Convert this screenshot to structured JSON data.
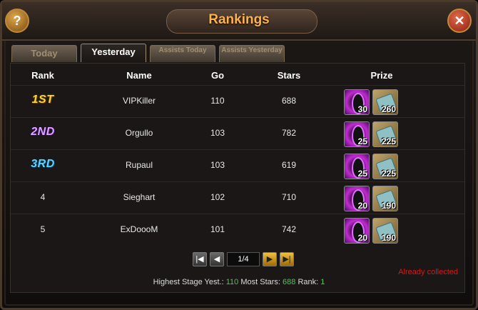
{
  "window": {
    "title": "Rankings"
  },
  "tabs": [
    {
      "label": "Today",
      "active": false
    },
    {
      "label": "Yesterday",
      "active": true
    },
    {
      "label": "Assists Today",
      "active": false
    },
    {
      "label": "Assists Yesterday",
      "active": false
    }
  ],
  "columns": {
    "rank": "Rank",
    "name": "Name",
    "go": "Go",
    "stars": "Stars",
    "prize": "Prize"
  },
  "rows": [
    {
      "rank": "1ST",
      "name": "VIPKiller",
      "go": "110",
      "stars": "688",
      "prize1": "30",
      "prize2": "260"
    },
    {
      "rank": "2ND",
      "name": "Orgullo",
      "go": "103",
      "stars": "782",
      "prize1": "25",
      "prize2": "225"
    },
    {
      "rank": "3RD",
      "name": "Rupaul",
      "go": "103",
      "stars": "619",
      "prize1": "25",
      "prize2": "225"
    },
    {
      "rank": "4",
      "name": "Sieghart",
      "go": "102",
      "stars": "710",
      "prize1": "20",
      "prize2": "190"
    },
    {
      "rank": "5",
      "name": "ExDoooM",
      "go": "101",
      "stars": "742",
      "prize1": "20",
      "prize2": "190"
    }
  ],
  "pager": {
    "page": "1/4"
  },
  "status": {
    "collected": "Already collected"
  },
  "footer": {
    "highest_label": "Highest Stage Yest.:",
    "highest_value": "110",
    "stars_label": "Most Stars:",
    "stars_value": "688",
    "rank_label": "Rank:",
    "rank_value": "1"
  },
  "icons": {
    "help": "question-icon",
    "close": "close-icon",
    "prize1": "dark-gem-icon",
    "prize2": "scroll-icon"
  },
  "colors": {
    "title": "#ffb24a",
    "collected": "#d21b1b",
    "highlight": "#3fd04a"
  }
}
